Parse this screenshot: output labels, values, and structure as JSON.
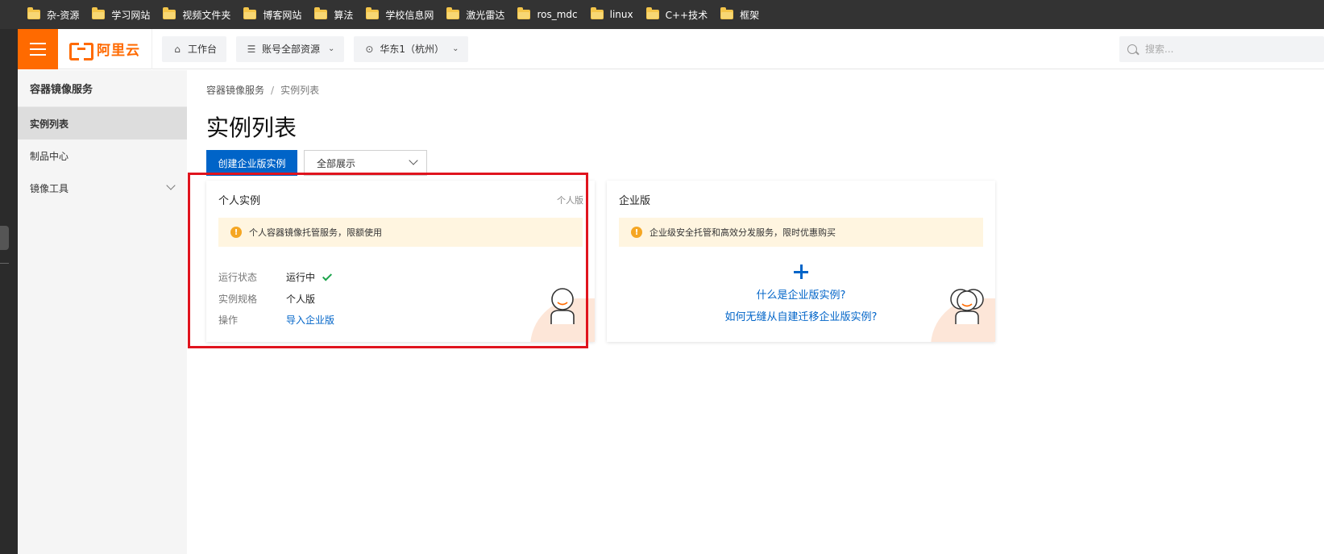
{
  "bookmarks": [
    {
      "label": "杂-资源"
    },
    {
      "label": "学习网站"
    },
    {
      "label": "视频文件夹"
    },
    {
      "label": "博客网站"
    },
    {
      "label": "算法"
    },
    {
      "label": "学校信息网"
    },
    {
      "label": "激光雷达"
    },
    {
      "label": "ros_mdc"
    },
    {
      "label": "linux"
    },
    {
      "label": "C++技术"
    },
    {
      "label": "框架"
    }
  ],
  "topbar": {
    "brand": "阿里云",
    "workbench": "工作台",
    "resources": "账号全部资源",
    "region": "华东1（杭州）",
    "search_placeholder": "搜索..."
  },
  "sidebar": {
    "title": "容器镜像服务",
    "items": [
      {
        "label": "实例列表",
        "active": true
      },
      {
        "label": "制品中心"
      },
      {
        "label": "镜像工具"
      }
    ]
  },
  "main": {
    "breadcrumb": [
      "容器镜像服务",
      "实例列表"
    ],
    "title": "实例列表",
    "create_button": "创建企业版实例",
    "filter_value": "全部展示",
    "personal": {
      "title": "个人实例",
      "tag": "个人版",
      "notice": "个人容器镜像托管服务，限额使用",
      "rows": [
        {
          "key": "运行状态",
          "value": "运行中"
        },
        {
          "key": "实例规格",
          "value": "个人版"
        },
        {
          "key": "操作",
          "value": "导入企业版"
        }
      ]
    },
    "enterprise": {
      "title": "企业版",
      "notice": "企业级安全托管和高效分发服务，限时优惠购买",
      "link1": "什么是企业版实例?",
      "link2": "如何无缝从自建迁移企业版实例?"
    }
  },
  "colors": {
    "brand_orange": "#ff6a00",
    "primary_blue": "#0064c8",
    "highlight_red": "#e0141e"
  }
}
